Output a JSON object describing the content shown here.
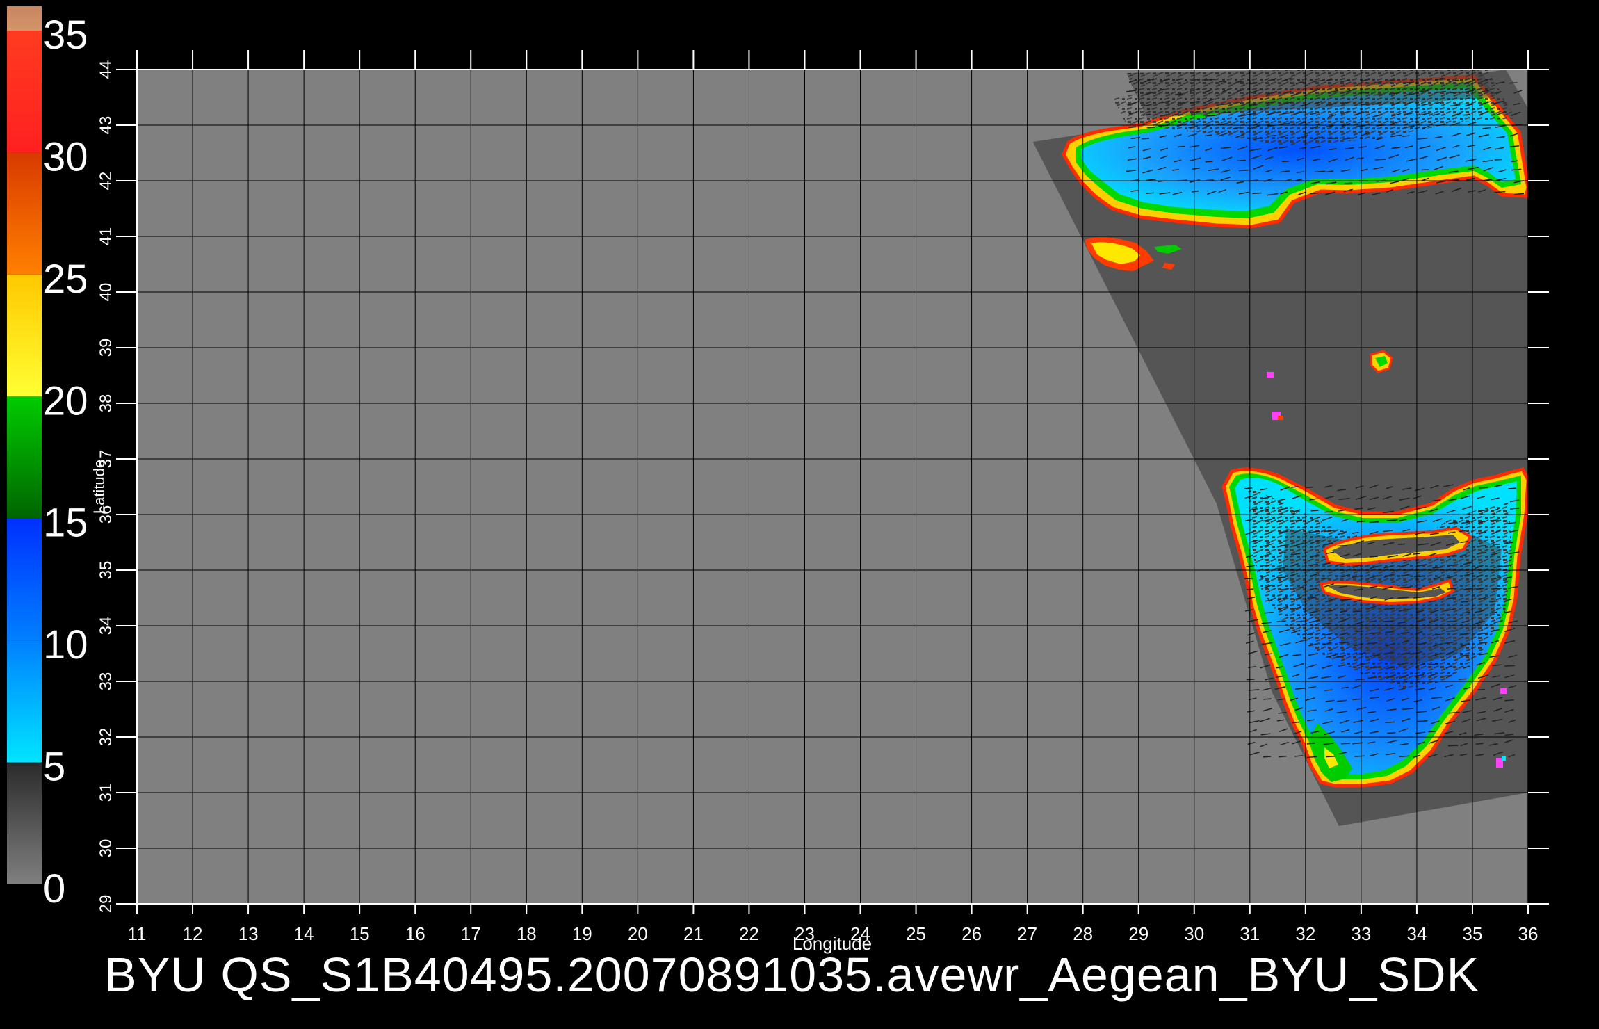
{
  "title": "BYU  QS_S1B40495.20070891035.avewr_Aegean_BYU_SDK",
  "axes": {
    "xlabel": "Longitude",
    "ylabel": "Latitude",
    "x_ticks": [
      "11",
      "12",
      "13",
      "14",
      "15",
      "16",
      "17",
      "18",
      "19",
      "20",
      "21",
      "22",
      "23",
      "24",
      "25",
      "26",
      "27",
      "28",
      "29",
      "30",
      "31",
      "32",
      "33",
      "34",
      "35",
      "36"
    ],
    "y_ticks": [
      "29",
      "30",
      "31",
      "32",
      "33",
      "34",
      "35",
      "36",
      "37",
      "38",
      "39",
      "40",
      "41",
      "42",
      "43",
      "44"
    ],
    "xlim": [
      11,
      36
    ],
    "ylim": [
      29,
      44
    ]
  },
  "colorbar": {
    "labels": [
      "35",
      "30",
      "25",
      "20",
      "15",
      "10",
      "5",
      "0"
    ],
    "range": [
      0,
      35
    ],
    "bands": [
      {
        "from": 0,
        "to": 5,
        "colors": [
          "#808080",
          "#2a2a2a"
        ]
      },
      {
        "from": 5,
        "to": 10,
        "colors": [
          "#00e5ff",
          "#0080ff"
        ]
      },
      {
        "from": 10,
        "to": 15,
        "colors": [
          "#0080ff",
          "#0030ff"
        ]
      },
      {
        "from": 15,
        "to": 20,
        "colors": [
          "#006400",
          "#00cc00"
        ]
      },
      {
        "from": 20,
        "to": 25,
        "colors": [
          "#ffff33",
          "#ffc800"
        ]
      },
      {
        "from": 25,
        "to": 30,
        "colors": [
          "#ff8000",
          "#d83a00"
        ]
      },
      {
        "from": 30,
        "to": 35,
        "colors": [
          "#ff2020",
          "#ff3b20"
        ]
      },
      {
        "from": 35,
        "to": 36,
        "colors": [
          "#d4956a",
          "#c88560"
        ]
      }
    ]
  },
  "colors": {
    "background": "#000000",
    "map_land": "#808080",
    "swath": "#555555",
    "grid": "#000000",
    "text": "#ffffff"
  },
  "map_data": {
    "type": "scatterometer wind speed map",
    "swath_polygon_lonlat": [
      [
        27.1,
        42.7
      ],
      [
        35.6,
        44.0
      ],
      [
        36.0,
        43.3
      ],
      [
        36.0,
        31.0
      ],
      [
        32.6,
        30.4
      ],
      [
        31.4,
        32.8
      ],
      [
        30.4,
        36.2
      ]
    ],
    "features": [
      {
        "name": "black-sea-wind-field",
        "color_range": "5-15"
      },
      {
        "name": "eastern-med-wind-field",
        "color_range": "5-15"
      },
      {
        "name": "marmara-wind-patch",
        "color_range": "20-30"
      }
    ]
  }
}
